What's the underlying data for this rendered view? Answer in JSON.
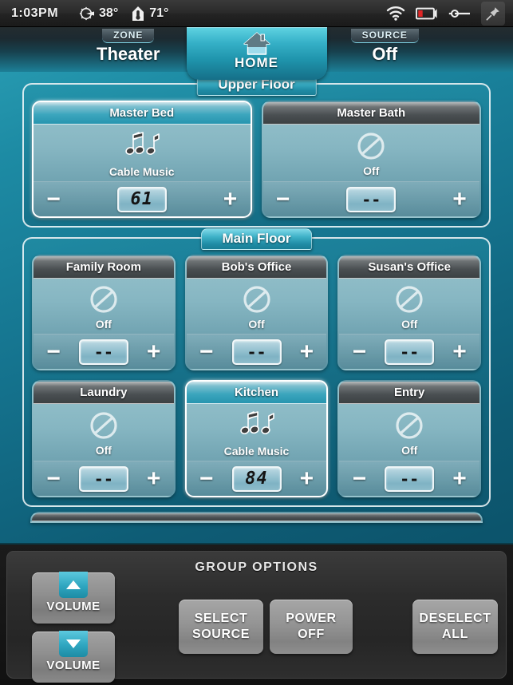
{
  "statusbar": {
    "time": "1:03PM",
    "outdoor_temp": "38°",
    "indoor_temp": "71°",
    "icons": {
      "outdoor": "sun-icon",
      "indoor": "thermometer-icon",
      "wifi": "wifi-icon",
      "battery": "battery-low-icon",
      "connector": "connector-icon",
      "pin": "pushpin-icon"
    },
    "battery_color": "#e02626"
  },
  "nav": {
    "zone_tag": "ZONE",
    "zone_value": "Theater",
    "home_label": "HOME",
    "source_tag": "SOURCE",
    "source_value": "Off"
  },
  "colors": {
    "accent": "#2fa9c0",
    "selected_border": "#ffffff",
    "panel_dark": "#2c2c2c"
  },
  "floors": [
    {
      "name": "Upper Floor",
      "rows": [
        [
          {
            "name": "Master Bed",
            "source": "Cable Music",
            "icon": "music-note-icon",
            "volume": "61",
            "selected": true,
            "minus": "−",
            "plus": "+"
          },
          {
            "name": "Master Bath",
            "source": "Off",
            "icon": "prohibited-icon",
            "volume": "--",
            "selected": false,
            "minus": "−",
            "plus": "+"
          }
        ]
      ]
    },
    {
      "name": "Main Floor",
      "rows": [
        [
          {
            "name": "Family Room",
            "source": "Off",
            "icon": "prohibited-icon",
            "volume": "--",
            "selected": false,
            "minus": "−",
            "plus": "+"
          },
          {
            "name": "Bob's Office",
            "source": "Off",
            "icon": "prohibited-icon",
            "volume": "--",
            "selected": false,
            "minus": "−",
            "plus": "+"
          },
          {
            "name": "Susan's Office",
            "source": "Off",
            "icon": "prohibited-icon",
            "volume": "--",
            "selected": false,
            "minus": "−",
            "plus": "+"
          }
        ],
        [
          {
            "name": "Laundry",
            "source": "Off",
            "icon": "prohibited-icon",
            "volume": "--",
            "selected": false,
            "minus": "−",
            "plus": "+"
          },
          {
            "name": "Kitchen",
            "source": "Cable Music",
            "icon": "music-note-icon",
            "volume": "84",
            "selected": true,
            "minus": "−",
            "plus": "+"
          },
          {
            "name": "Entry",
            "source": "Off",
            "icon": "prohibited-icon",
            "volume": "--",
            "selected": false,
            "minus": "−",
            "plus": "+"
          }
        ]
      ]
    }
  ],
  "group_options": {
    "title": "GROUP OPTIONS",
    "volume_up_label": "VOLUME",
    "volume_down_label": "VOLUME",
    "buttons": [
      {
        "line1": "SELECT",
        "line2": "SOURCE"
      },
      {
        "line1": "POWER",
        "line2": "OFF"
      },
      {
        "line1": "DESELECT",
        "line2": "ALL"
      }
    ]
  }
}
